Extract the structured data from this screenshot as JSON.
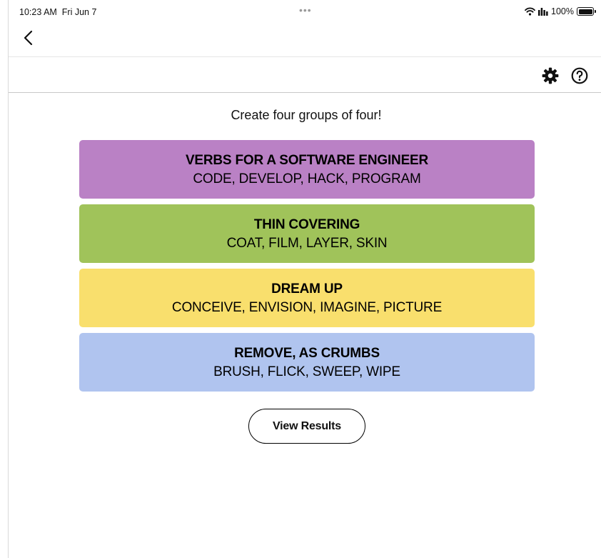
{
  "status_bar": {
    "time": "10:23 AM",
    "date": "Fri Jun 7",
    "more_indicator": "•••",
    "battery_percent": "100%",
    "icons": [
      "wifi-icon",
      "signal-icon",
      "battery-icon"
    ]
  },
  "nav": {
    "back_icon": "chevron-left-icon"
  },
  "toolbar": {
    "icons": [
      "gear-icon",
      "help-circle-icon"
    ]
  },
  "game": {
    "instruction": "Create four groups of four!",
    "groups": [
      {
        "title": "VERBS FOR A SOFTWARE ENGINEER",
        "words": "CODE, DEVELOP, HACK, PROGRAM",
        "color": "#ba81c5"
      },
      {
        "title": "THIN COVERING",
        "words": "COAT, FILM, LAYER, SKIN",
        "color": "#a0c35a"
      },
      {
        "title": "DREAM UP",
        "words": "CONCEIVE, ENVISION, IMAGINE, PICTURE",
        "color": "#f9df6d"
      },
      {
        "title": "REMOVE, AS CRUMBS",
        "words": "BRUSH, FLICK, SWEEP, WIPE",
        "color": "#b0c4ef"
      }
    ],
    "view_results_label": "View Results"
  }
}
